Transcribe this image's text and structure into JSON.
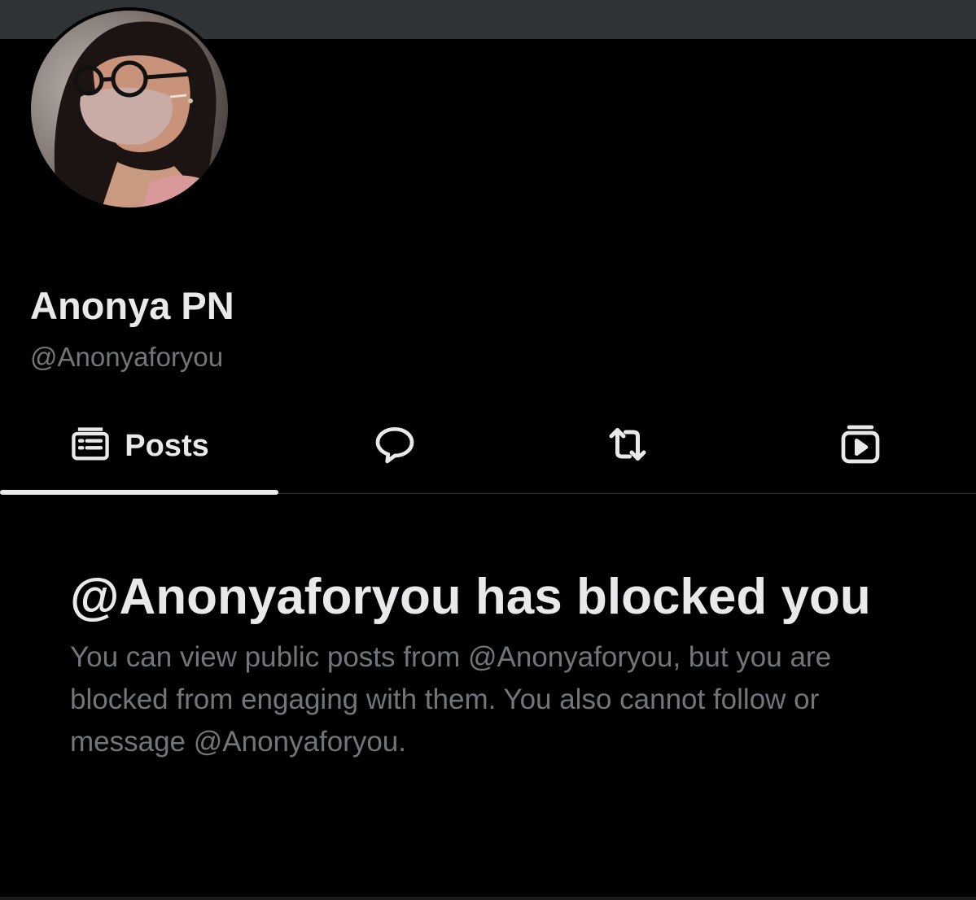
{
  "profile": {
    "display_name": "Anonya PN",
    "handle": "@Anonyaforyou",
    "avatar_icon": "profile-photo"
  },
  "tabs": [
    {
      "label": "Posts",
      "icon": "posts-icon",
      "active": true
    },
    {
      "label": "",
      "icon": "replies-icon",
      "active": false
    },
    {
      "label": "",
      "icon": "reposts-icon",
      "active": false
    },
    {
      "label": "",
      "icon": "media-icon",
      "active": false
    }
  ],
  "blocked": {
    "title": "@Anonyaforyou has blocked you",
    "message": "You can view public posts from @Anonyaforyou, but you are blocked from engaging with them. You also cannot follow or message @Anonyaforyou."
  },
  "colors": {
    "background": "#000000",
    "banner": "#2f3336",
    "primary_text": "#e7e9ea",
    "secondary_text": "#71767b"
  }
}
